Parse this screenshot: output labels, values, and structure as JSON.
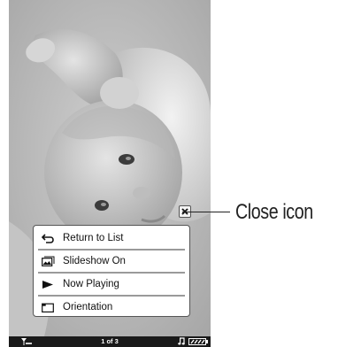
{
  "screen": {
    "photo_alt": "Baby photo",
    "close_icon": "close-icon"
  },
  "menu": {
    "items": [
      {
        "label": "Return to List",
        "icon": "return-arrow-icon"
      },
      {
        "label": "Slideshow On",
        "icon": "slideshow-icon"
      },
      {
        "label": "Now Playing",
        "icon": "play-icon"
      },
      {
        "label": "Orientation",
        "icon": "orientation-icon"
      }
    ]
  },
  "statusbar": {
    "page_indicator": "1 of 3"
  },
  "callout": {
    "label": "Close icon"
  }
}
